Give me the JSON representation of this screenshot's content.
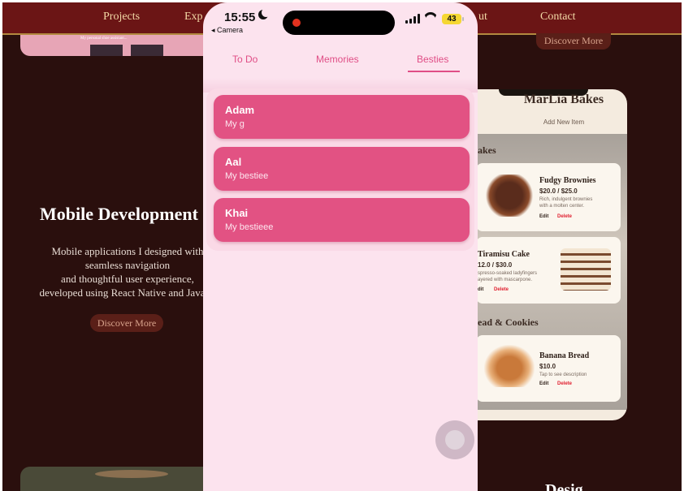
{
  "background_site": {
    "nav": [
      "Projects",
      "Exp",
      "ut",
      "Contact"
    ],
    "pink_card_text": "My personal shoe assistant...",
    "discover_top": "Discover More",
    "section_title": "Mobile Development",
    "section_desc": [
      "Mobile applications I designed with",
      "seamless navigation",
      "and thoughtful user experience,",
      "developed using React Native and JavaSc"
    ],
    "discover_button": "Discover More",
    "bottom_right_title": "Desig"
  },
  "bakery": {
    "title": "MarLia Bakes",
    "add_new": "Add New Item",
    "category_1": "akes",
    "category_2": "ead & Cookies",
    "items": [
      {
        "name": "Fudgy Brownies",
        "price": "$20.0 / $25.0",
        "desc": [
          "Rich, indulgent brownies",
          "with a molten center."
        ],
        "edit": "Edit",
        "delete": "Delete"
      },
      {
        "name": "Tiramisu Cake",
        "price": "12.0 / $30.0",
        "desc": [
          "spresso-soaked ladyfingers",
          "ayered with mascarpone."
        ],
        "edit": "dit",
        "delete": "Delete"
      },
      {
        "name": "Banana Bread",
        "price": "$10.0",
        "desc": [
          "Tap to see description"
        ],
        "edit": "Edit",
        "delete": "Delete"
      }
    ]
  },
  "phone": {
    "status": {
      "time": "15:55",
      "back_label": "◂ Camera",
      "battery": "43"
    },
    "tabs": [
      {
        "label": "To Do",
        "active": false
      },
      {
        "label": "Memories",
        "active": false
      },
      {
        "label": "Besties",
        "active": true
      }
    ],
    "friends": [
      {
        "name": "Adam",
        "description": "My g"
      },
      {
        "name": "Aal",
        "description": "My bestiee"
      },
      {
        "name": "Khai",
        "description": "My bestieee"
      }
    ],
    "accent_color": "#e25283"
  }
}
